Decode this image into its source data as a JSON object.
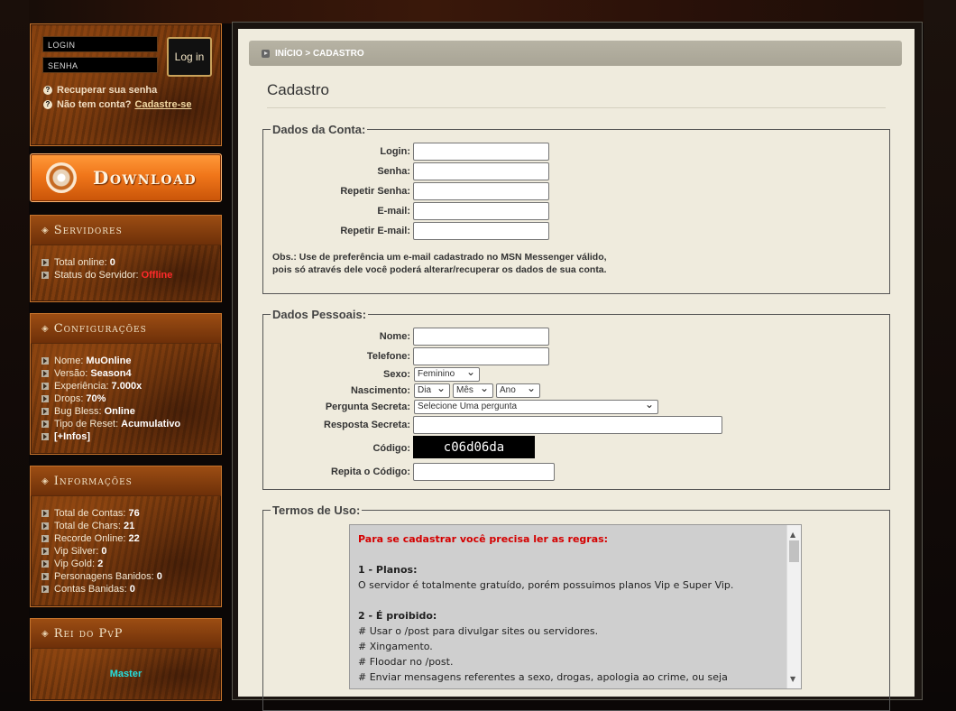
{
  "sidebar": {
    "login_placeholder": "LOGIN",
    "password_placeholder": "SENHA",
    "login_button": "Log in",
    "recover_link": "Recuperar sua senha",
    "no_account_text": "Não tem conta?",
    "register_link": "Cadastre-se",
    "download_label": "Download",
    "servers": {
      "title": "Servidores",
      "items": [
        {
          "label": "Total online:",
          "value": "0",
          "value_color": "#ffffff"
        },
        {
          "label": "Status do Servidor:",
          "value": "Offline",
          "value_color": "#ff2a2a"
        }
      ]
    },
    "config": {
      "title": "Configurações",
      "items": [
        {
          "label": "Nome:",
          "value": "MuOnline"
        },
        {
          "label": "Versão:",
          "value": "Season4"
        },
        {
          "label": "Experiência:",
          "value": "7.000x"
        },
        {
          "label": "Drops:",
          "value": "70%"
        },
        {
          "label": "Bug Bless:",
          "value": "Online"
        },
        {
          "label": "Tipo de Reset:",
          "value": "Acumulativo"
        },
        {
          "label": "",
          "value": "[+Infos]"
        }
      ]
    },
    "info": {
      "title": "Informações",
      "items": [
        {
          "label": "Total de Contas:",
          "value": "76"
        },
        {
          "label": "Total de Chars:",
          "value": "21"
        },
        {
          "label": "Recorde Online:",
          "value": "22"
        },
        {
          "label": "Vip Silver:",
          "value": "0"
        },
        {
          "label": "Vip Gold:",
          "value": "2"
        },
        {
          "label": "Personagens Banidos:",
          "value": "0"
        },
        {
          "label": "Contas Banidas:",
          "value": "0"
        }
      ]
    },
    "pvp": {
      "title": "Rei do PvP",
      "player": "Master",
      "player_color": "#22e0e0"
    }
  },
  "breadcrumb": "INÍCIO > CADASTRO",
  "page_title": "Cadastro",
  "account": {
    "legend": "Dados da Conta:",
    "fields": [
      "Login:",
      "Senha:",
      "Repetir Senha:",
      "E-mail:",
      "Repetir E-mail:"
    ],
    "obs_label": "Obs.:",
    "obs_line1": "Use de preferência um e-mail cadastrado no MSN Messenger válido,",
    "obs_line2": "pois só através dele você poderá alterar/recuperar os dados de sua conta."
  },
  "personal": {
    "legend": "Dados Pessoais:",
    "name_label": "Nome:",
    "phone_label": "Telefone:",
    "sex_label": "Sexo:",
    "sex_value": "Feminino",
    "birth_label": "Nascimento:",
    "day": "Dia",
    "month": "Mês",
    "year": "Ano",
    "question_label": "Pergunta Secreta:",
    "question_value": "Selecione Uma pergunta",
    "answer_label": "Resposta Secreta:",
    "code_label": "Código:",
    "captcha": "c06d06da",
    "repeat_code_label": "Repita o Código:"
  },
  "terms": {
    "legend": "Termos de Uso:",
    "intro": "Para se cadastrar você precisa ler as regras:",
    "s1_title": "1 - Planos:",
    "s1_text": "O servidor é totalmente gratuído, porém possuimos planos Vip e Super Vip.",
    "s2_title": "2 - É proibido:",
    "rules": [
      "# Usar o /post para divulgar sites ou servidores.",
      "# Xingamento.",
      "# Floodar no /post.",
      "# Enviar mensagens referentes a sexo, drogas, apologia ao crime, ou seja"
    ]
  }
}
